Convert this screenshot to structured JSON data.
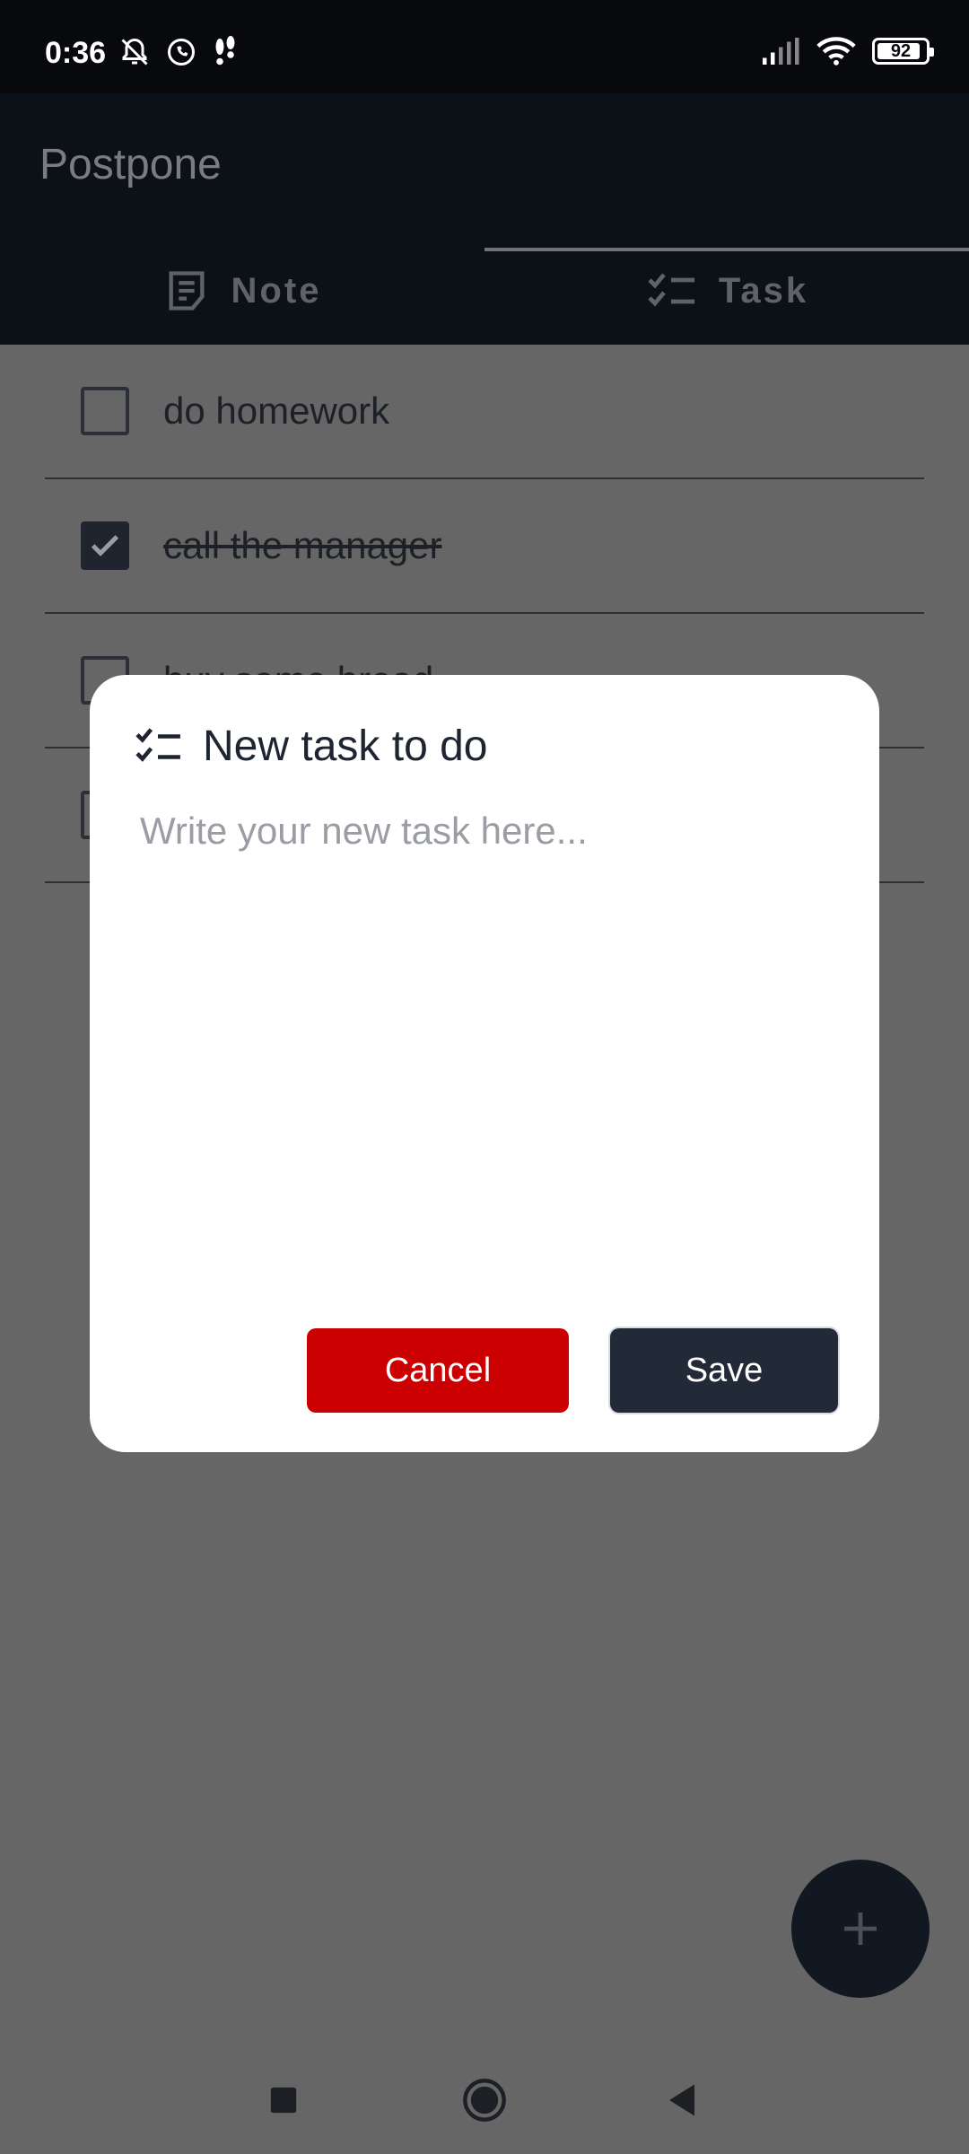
{
  "status_bar": {
    "time": "0:36",
    "battery_level": "92",
    "icons_left": [
      "notifications-off-icon",
      "whatsapp-icon",
      "steps-icon"
    ],
    "icons_right": [
      "signal-icon",
      "wifi-icon",
      "battery-icon"
    ]
  },
  "app": {
    "title": "Postpone",
    "tabs": [
      {
        "label": "Note",
        "icon": "note-icon",
        "selected": false
      },
      {
        "label": "Task",
        "icon": "checklist-icon",
        "selected": true
      }
    ]
  },
  "tasks": [
    {
      "text": "do homework",
      "done": false
    },
    {
      "text": "call the manager",
      "done": true
    },
    {
      "text": "buy some bread",
      "done": false
    },
    {
      "text": "",
      "done": false
    }
  ],
  "dialog": {
    "title": "New task to do",
    "input_placeholder": "Write your new task here...",
    "input_value": "",
    "cancel_label": "Cancel",
    "save_label": "Save"
  },
  "fab": {
    "label": "+"
  },
  "colors": {
    "status_bar_bg": "#07090d",
    "app_bar_bg": "#0c1017",
    "scrim": "#666666",
    "cancel": "#cc0000",
    "save": "#222937",
    "fab": "#121822"
  },
  "nav_bar": {
    "buttons": [
      "recents-icon",
      "home-icon",
      "back-icon"
    ]
  }
}
